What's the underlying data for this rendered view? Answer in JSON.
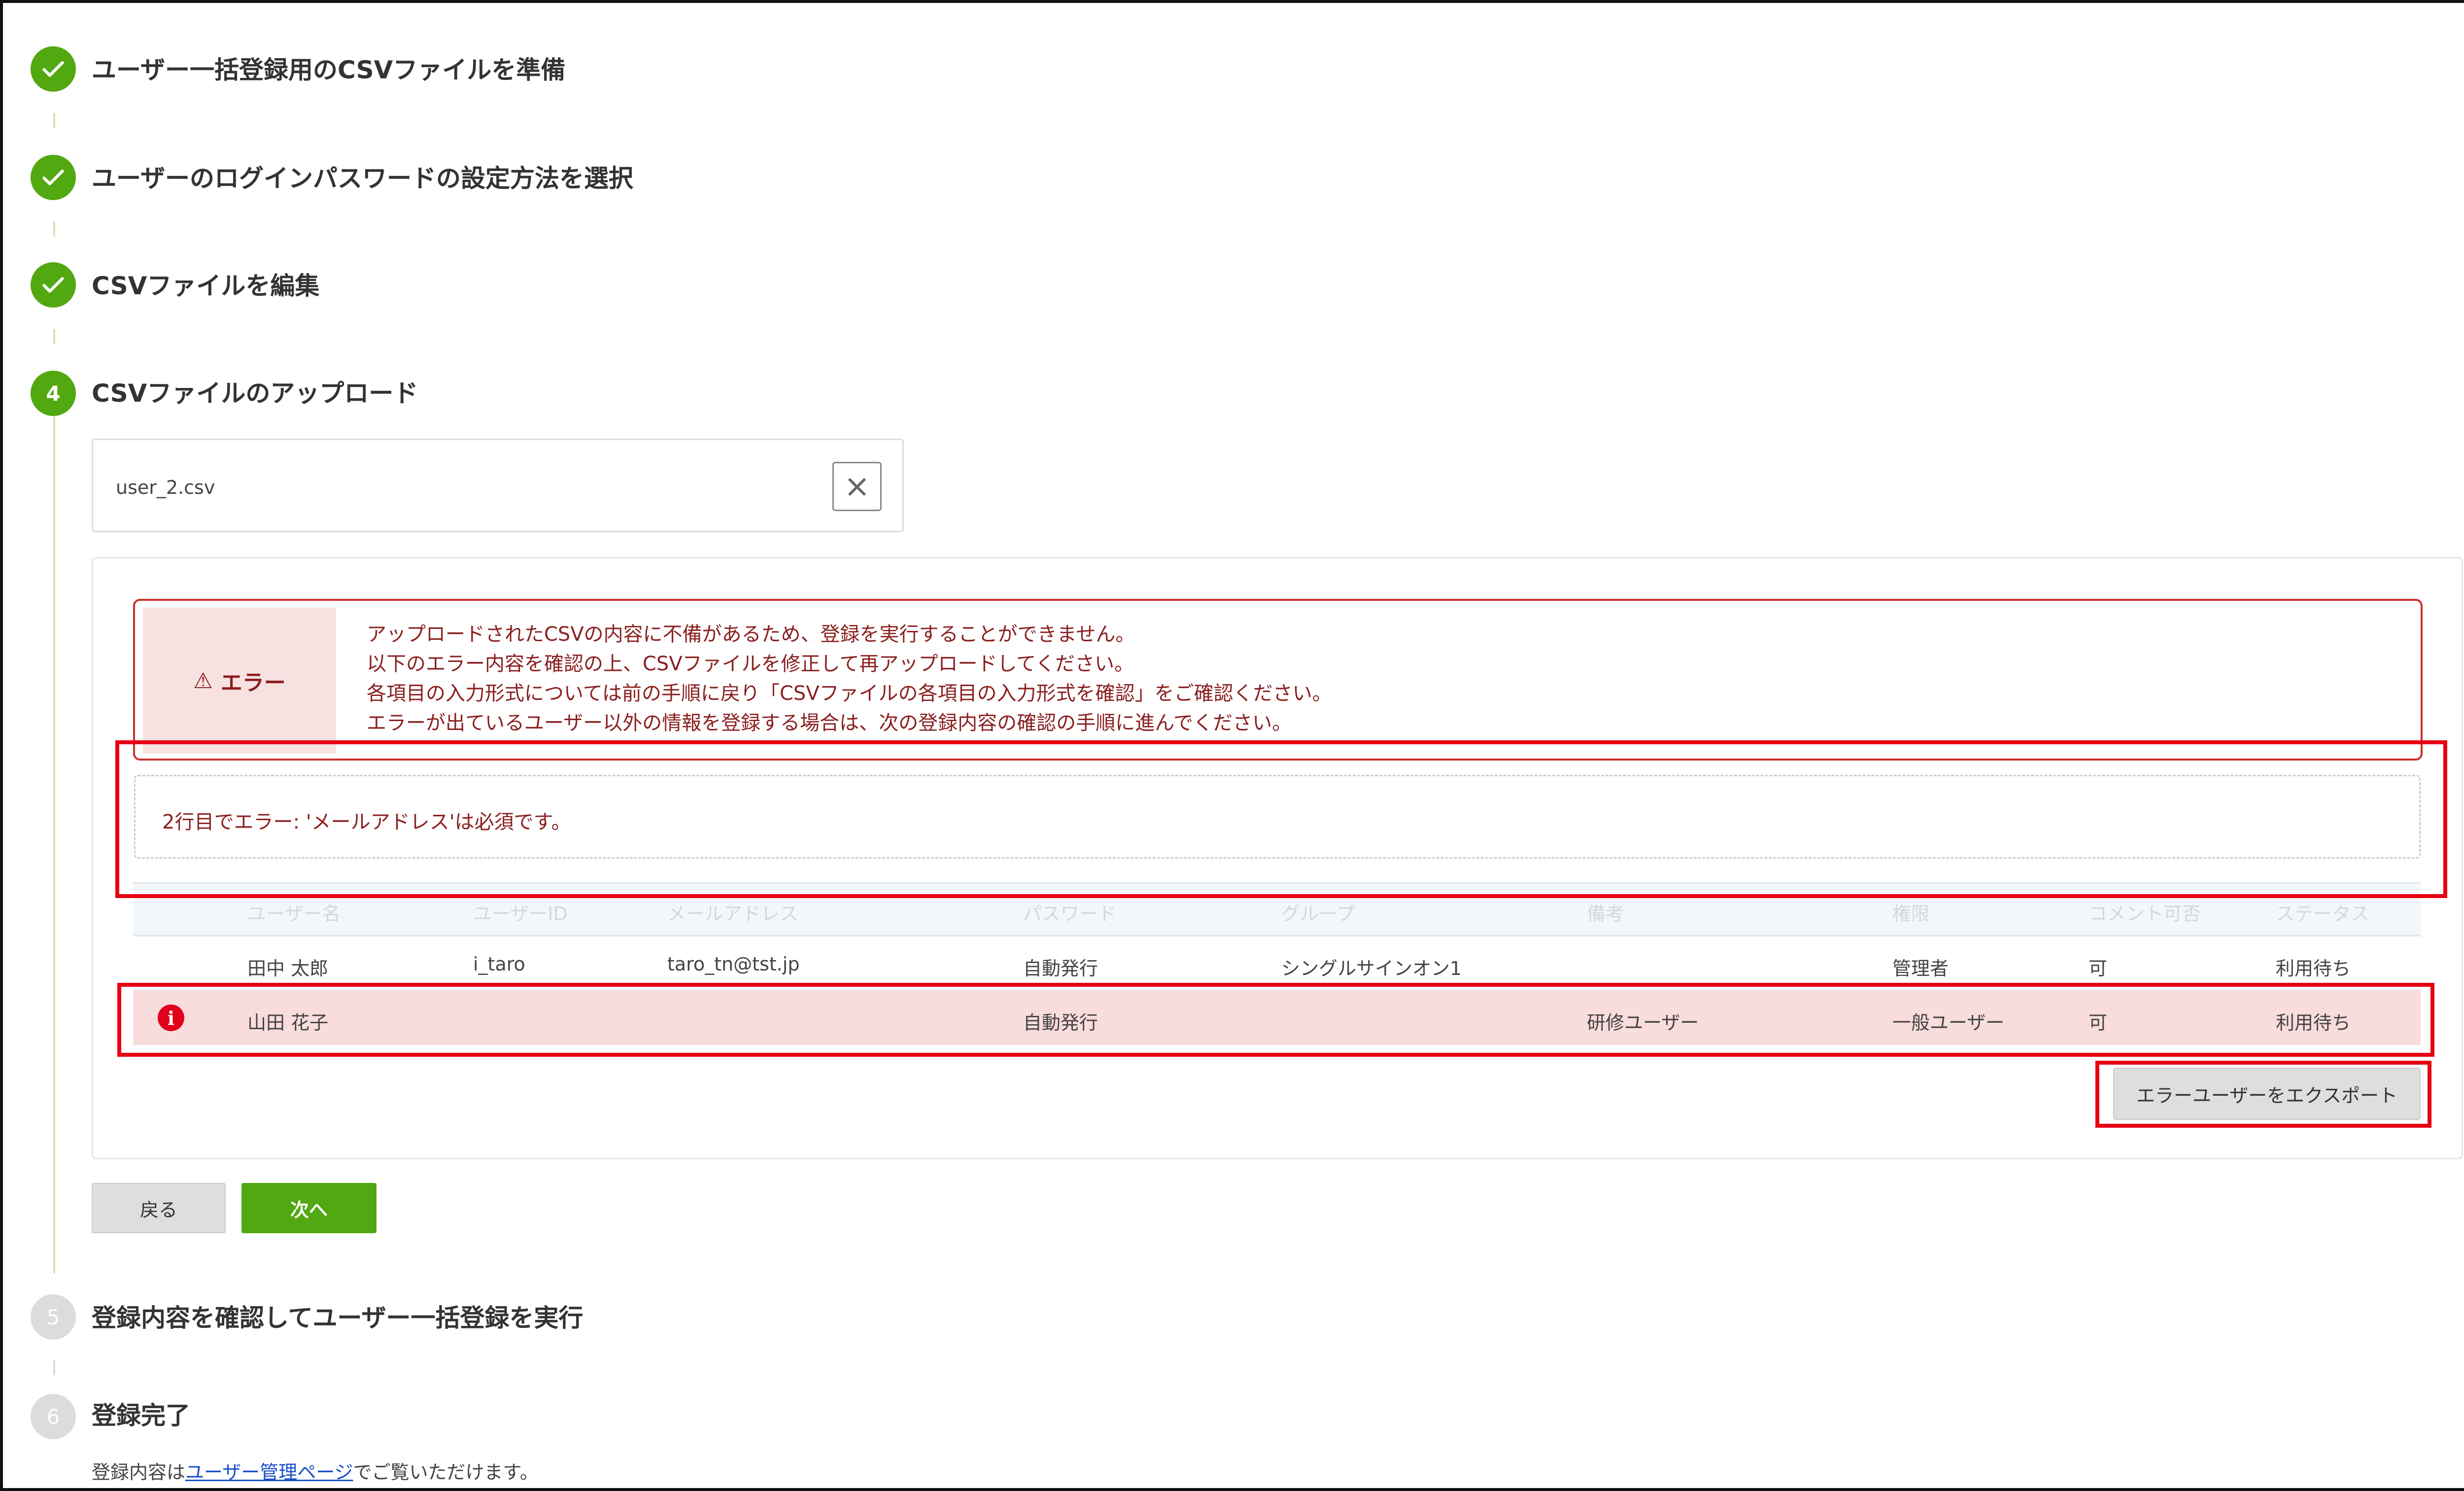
{
  "steps": [
    {
      "number": "",
      "title": "ユーザー一括登録用のCSVファイルを準備",
      "status": "done"
    },
    {
      "number": "",
      "title": "ユーザーのログインパスワードの設定方法を選択",
      "status": "done"
    },
    {
      "number": "",
      "title": "CSVファイルを編集",
      "status": "done"
    },
    {
      "number": "4",
      "title": "CSVファイルのアップロード",
      "status": "active"
    },
    {
      "number": "5",
      "title": "登録内容を確認してユーザー一括登録を実行",
      "status": "pending"
    },
    {
      "number": "6",
      "title": "登録完了",
      "status": "pending"
    }
  ],
  "upload": {
    "file_name": "user_2.csv",
    "clear_icon": "×"
  },
  "error": {
    "label": "エラー",
    "icon": "⚠",
    "lines": [
      "アップロードされたCSVの内容に不備があるため、登録を実行することができません。",
      "以下のエラー内容を確認の上、CSVファイルを修正して再アップロードしてください。",
      "各項目の入力形式については前の手順に戻り「CSVファイルの各項目の入力形式を確認」をご確認ください。",
      "エラーが出ているユーザー以外の情報を登録する場合は、次の登録内容の確認の手順に進んでください。"
    ],
    "detail": "2行目でエラー: 'メールアドレス'は必須です。"
  },
  "table": {
    "headers": [
      "ユーザー名",
      "ユーザーID",
      "メールアドレス",
      "パスワード",
      "グループ",
      "備考",
      "権限",
      "コメント可否",
      "ステータス"
    ],
    "rows": [
      {
        "has_error": false,
        "cells": [
          "田中 太郎",
          "i_taro",
          "taro_tn@tst.jp",
          "自動発行",
          "シングルサインオン1",
          "",
          "管理者",
          "可",
          "利用待ち"
        ]
      },
      {
        "has_error": true,
        "cells": [
          "山田 花子",
          "",
          "",
          "自動発行",
          "",
          "研修ユーザー",
          "一般ユーザー",
          "可",
          "利用待ち"
        ]
      }
    ]
  },
  "buttons": {
    "export": "エラーユーザーをエクスポート",
    "back": "戻る",
    "next": "次へ"
  },
  "footer": {
    "prefix": "登録内容は",
    "link": "ユーザー管理ページ",
    "suffix": "でご覧いただけます。"
  },
  "colors": {
    "accent_green": "#52a810",
    "error_text": "#8b1f1f",
    "error_bg": "#f7e1e1",
    "annotation_red": "#e60012",
    "link_blue": "#1a4fc9"
  }
}
